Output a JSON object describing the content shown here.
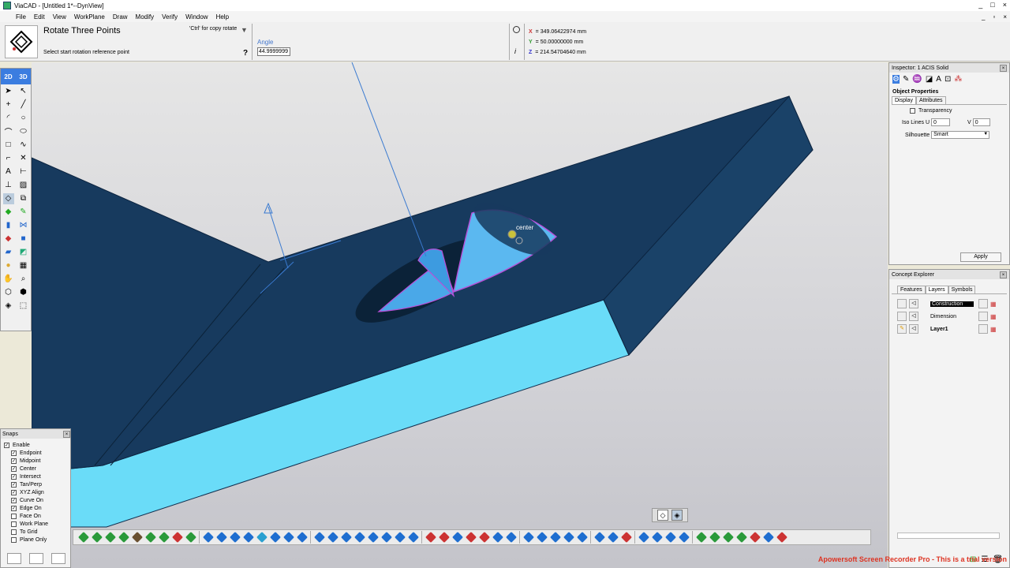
{
  "window": {
    "title": "ViaCAD - [Untitled 1*--DynView]",
    "buttons": [
      "_",
      "□",
      "×"
    ]
  },
  "menubar": {
    "items": [
      "File",
      "Edit",
      "View",
      "WorkPlane",
      "Draw",
      "Modify",
      "Verify",
      "Window",
      "Help"
    ],
    "mdi_buttons": [
      "_",
      "▫",
      "×"
    ]
  },
  "tool": {
    "title": "Rotate Three Points",
    "hint": "'Ctrl' for copy rotate",
    "prompt": "Select start rotation reference point",
    "help": "?",
    "angle_label": "Angle",
    "angle_value": "44.9999999"
  },
  "coords": {
    "x_label": "X",
    "x_value": "= 349.06422974 mm",
    "y_label": "Y",
    "y_value": "= 50.00000000 mm",
    "z_label": "Z",
    "z_value": "= 214.54704640 mm",
    "info": "i"
  },
  "palette": {
    "mode_2d": "2D",
    "mode_3d": "3D"
  },
  "snaps": {
    "title": "Snaps",
    "close": "×",
    "enable_label": "Enable",
    "items": [
      {
        "label": "Endpoint",
        "checked": true
      },
      {
        "label": "Midpoint",
        "checked": true
      },
      {
        "label": "Center",
        "checked": true
      },
      {
        "label": "Intersect",
        "checked": true
      },
      {
        "label": "Tan/Perp",
        "checked": true
      },
      {
        "label": "XYZ Align",
        "checked": true
      },
      {
        "label": "Curve On",
        "checked": true
      },
      {
        "label": "Edge On",
        "checked": true
      },
      {
        "label": "Face On",
        "checked": false
      },
      {
        "label": "Work Plane",
        "checked": false
      },
      {
        "label": "To Grid",
        "checked": false
      },
      {
        "label": "Plane Only",
        "checked": false
      }
    ]
  },
  "inspector": {
    "title": "Inspector: 1 ACIS Solid",
    "close": "×",
    "section": "Object Properties",
    "tab_display": "Display",
    "tab_attributes": "Attributes",
    "transparency_label": "Transparency",
    "iso_u_label": "Iso Lines U",
    "iso_u_value": "0",
    "iso_v_label": "V",
    "iso_v_value": "0",
    "silhouette_label": "Silhouette",
    "silhouette_value": "Smart",
    "apply_label": "Apply"
  },
  "concept": {
    "title": "Concept Explorer",
    "close": "×",
    "tabs": [
      "Features",
      "Layers",
      "Symbols"
    ],
    "layers": [
      {
        "name": "Construction",
        "selected": true
      },
      {
        "name": "Dimension",
        "selected": false
      },
      {
        "name": "Layer1",
        "selected": false
      }
    ]
  },
  "viewport": {
    "snap_label": "center"
  },
  "watermark": "Apowersoft Screen Recorder Pro - This is a trial version",
  "colors": {
    "solid_dark": "#183a5e",
    "solid_cyan": "#6adcf8",
    "highlight": "#b84fd8",
    "accent": "#4477cc"
  }
}
